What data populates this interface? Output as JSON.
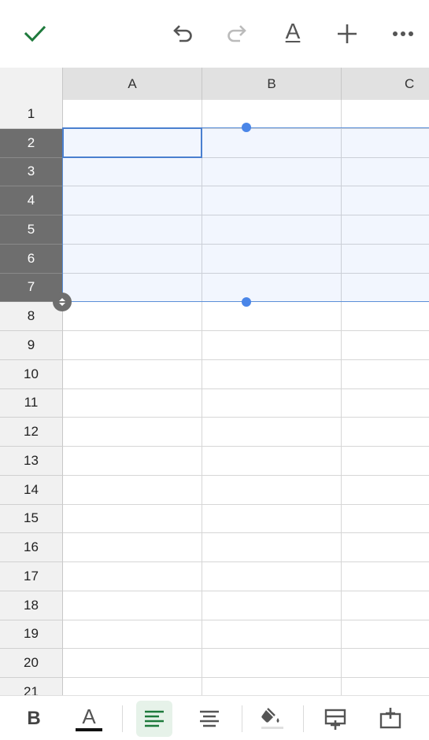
{
  "toolbar": {
    "confirm_icon": "check-icon",
    "undo_icon": "undo-icon",
    "redo_icon": "redo-icon",
    "text_format_icon": "text-format-icon",
    "text_format_label": "A",
    "insert_icon": "plus-icon",
    "more_icon": "more-icon"
  },
  "sheet": {
    "columns": [
      "A",
      "B",
      "C"
    ],
    "rows": [
      "1",
      "2",
      "3",
      "4",
      "5",
      "6",
      "7",
      "8",
      "9",
      "10",
      "11",
      "12",
      "13",
      "14",
      "15",
      "16",
      "17",
      "18",
      "19",
      "20",
      "21"
    ],
    "selected_rows": [
      "2",
      "3",
      "4",
      "5",
      "6",
      "7"
    ]
  },
  "format_bar": {
    "bold_label": "B",
    "text_color_label": "A"
  },
  "colors": {
    "accent_green": "#1e7a3c",
    "selection_blue": "#4a86e8",
    "selected_header": "#6e6e6e"
  }
}
